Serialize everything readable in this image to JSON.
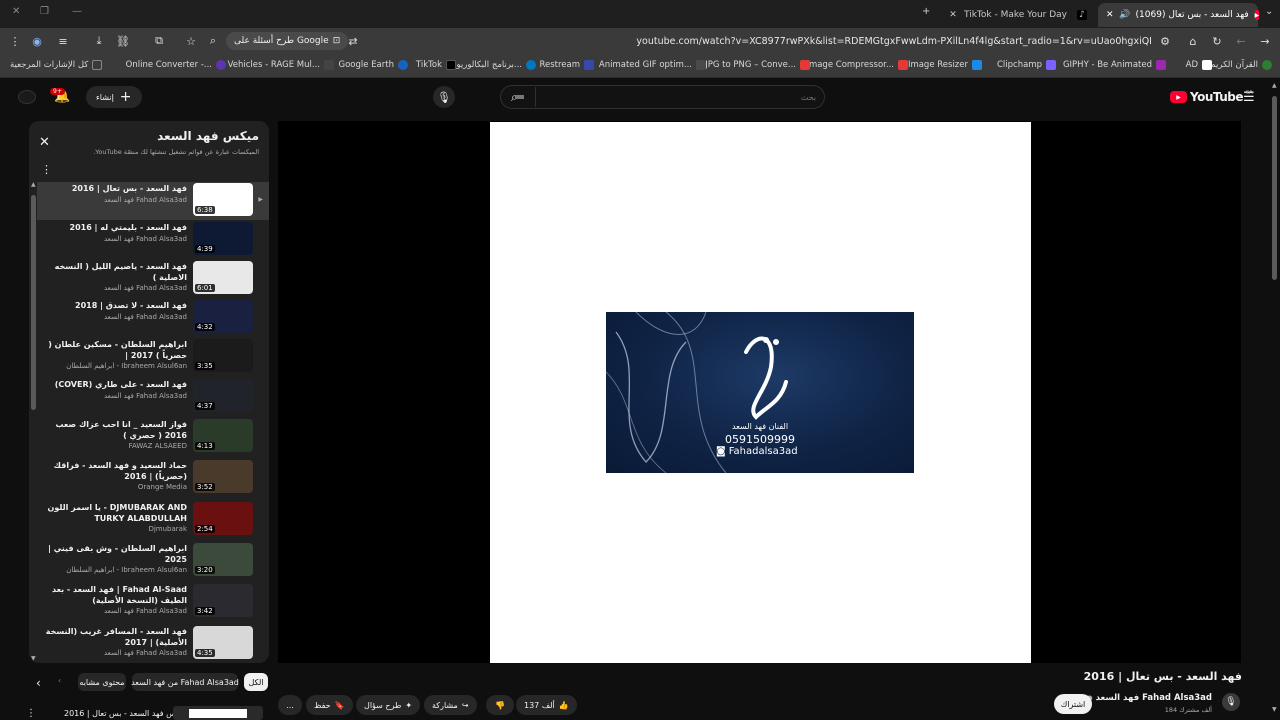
{
  "browser": {
    "tabs": [
      {
        "label": "TikTok - Make Your Day"
      },
      {
        "label": "(1069) فهد السعد - بس تعال"
      }
    ],
    "url": "youtube.com/watch?v=XC8977rwPXk&list=RDEMGtgxFwwLdm-PXilLn4f4lg&start_radio=1&rv=uUao0hgxiQI",
    "google_search_label": "طرح أسئلة على Google",
    "bookmarks": [
      {
        "label": "القرآن الكريم",
        "color": "#2e7d32"
      },
      {
        "label": "AD",
        "color": "#ffffff"
      },
      {
        "label": "GIPHY - Be Animated",
        "color": "#9c27b0"
      },
      {
        "label": "Clipchamp",
        "color": "#7b61ff"
      },
      {
        "label": "Image Resizer",
        "color": "#1e88e5"
      },
      {
        "label": "Image Compressor...",
        "color": "#e53935"
      },
      {
        "label": "JPG to PNG – Conve...",
        "color": "#e53935"
      },
      {
        "label": "Animated GIF optim...",
        "color": "#4a4a4a"
      },
      {
        "label": "Restream",
        "color": "#3949ab"
      },
      {
        "label": "برنامج البكالوريوس...",
        "color": "#0277bd"
      },
      {
        "label": "TikTok",
        "color": "#000000"
      },
      {
        "label": "Google Earth",
        "color": "#1565c0"
      },
      {
        "label": "Vehicles - RAGE Mul...",
        "color": "#444444"
      },
      {
        "label": "Online Converter -...",
        "color": "#5e35b1"
      },
      {
        "label": "كل الإشارات المرجعية",
        "color": "#888888"
      }
    ]
  },
  "youtube": {
    "logo_label": "YouTube",
    "region": "SA",
    "search_placeholder": "بحث",
    "create_label": "إنشاء",
    "notifications_badge": "9+"
  },
  "playlist": {
    "title": "ميكس فهد السعد",
    "subtitle": "الميكسات عبارة عن قوائم تشغيل تنشئها لك منصّة YouTube.",
    "items": [
      {
        "title": "فهد السعد - بس تعال | 2016",
        "channel": "فهد السعد Fahad Alsa3ad",
        "duration": "6:38",
        "color": "#ffffff"
      },
      {
        "title": "فهد السعد - بليمتي له | 2016",
        "channel": "فهد السعد Fahad Alsa3ad",
        "duration": "4:39",
        "color": "#0e1a33"
      },
      {
        "title": "فهد السعد - ياصيم الليل ( النسخه الاصلية )",
        "channel": "فهد السعد Fahad Alsa3ad",
        "duration": "6:01",
        "color": "#e8e8e8"
      },
      {
        "title": "فهد السعد - لا تصدق | 2018",
        "channel": "فهد السعد Fahad Alsa3ad",
        "duration": "4:32",
        "color": "#1a2140"
      },
      {
        "title": "ابراهيم السلطان - مسكين علطان ( حصرياً ) 2017 |",
        "channel": "ابراهيم السلطان - Ibraheem Alsul6an",
        "duration": "3:35",
        "color": "#1b1b1b"
      },
      {
        "title": "فهد السعد - على طاري (COVER)",
        "channel": "فهد السعد Fahad Alsa3ad",
        "duration": "4:37",
        "color": "#20232a"
      },
      {
        "title": "فواز السعيد _ انا احب عزاك صعب 2016 ( حصري )",
        "channel": "FAWAZ ALSAEED",
        "duration": "4:13",
        "color": "#2a3b2a"
      },
      {
        "title": "حماد السعيد و فهد السعد - فراقك (حصرياً) | 2016",
        "channel": "Orange Media",
        "duration": "3:52",
        "color": "#4a3a2c"
      },
      {
        "title": "DJMUBARAK AND - يا اسمر اللون TURKY ALABDULLAH",
        "channel": "Djmubarak",
        "duration": "2:54",
        "color": "#6a1010"
      },
      {
        "title": "ابراهيم السلطان - وش بقى فيني | 2025",
        "channel": "ابراهيم السلطان - Ibraheem Alsul6an",
        "duration": "3:20",
        "color": "#3c4a3c"
      },
      {
        "title": "Fahad Al-Saad | فهد السعد - بعد الطيف (النسخة الأصلية)",
        "channel": "فهد السعد Fahad Alsa3ad",
        "duration": "3:42",
        "color": "#2a2a30"
      },
      {
        "title": "فهد السعد - المسافر غريب (النسخة الأصلية) | 2017",
        "channel": "فهد السعد Fahad Alsa3ad",
        "duration": "4:35",
        "color": "#d8d8d8"
      }
    ]
  },
  "video": {
    "art_caption_name": "الفنان فهد السعد",
    "art_caption_phone": "0591509999",
    "art_caption_handle": "Fahadalsa3ad",
    "title": "فهد السعد - بس تعال | 2016",
    "channel": "فهد السعد Fahad Alsa3ad",
    "subscribers": "184 ألف مشترك",
    "subscribe_label": "اشتراك",
    "likes": "137 ألف",
    "share_label": "مشاركة",
    "ask_label": "طرح سؤال",
    "save_label": "حفظ",
    "more_label": "..."
  },
  "chips": {
    "all": "الكل",
    "from_channel": "من فهد السعد Fahad Alsa3ad",
    "related": "محتوى مشابه"
  },
  "miniplayer": {
    "title": "ميكس فهد السعد - بس تعال | 2016"
  }
}
